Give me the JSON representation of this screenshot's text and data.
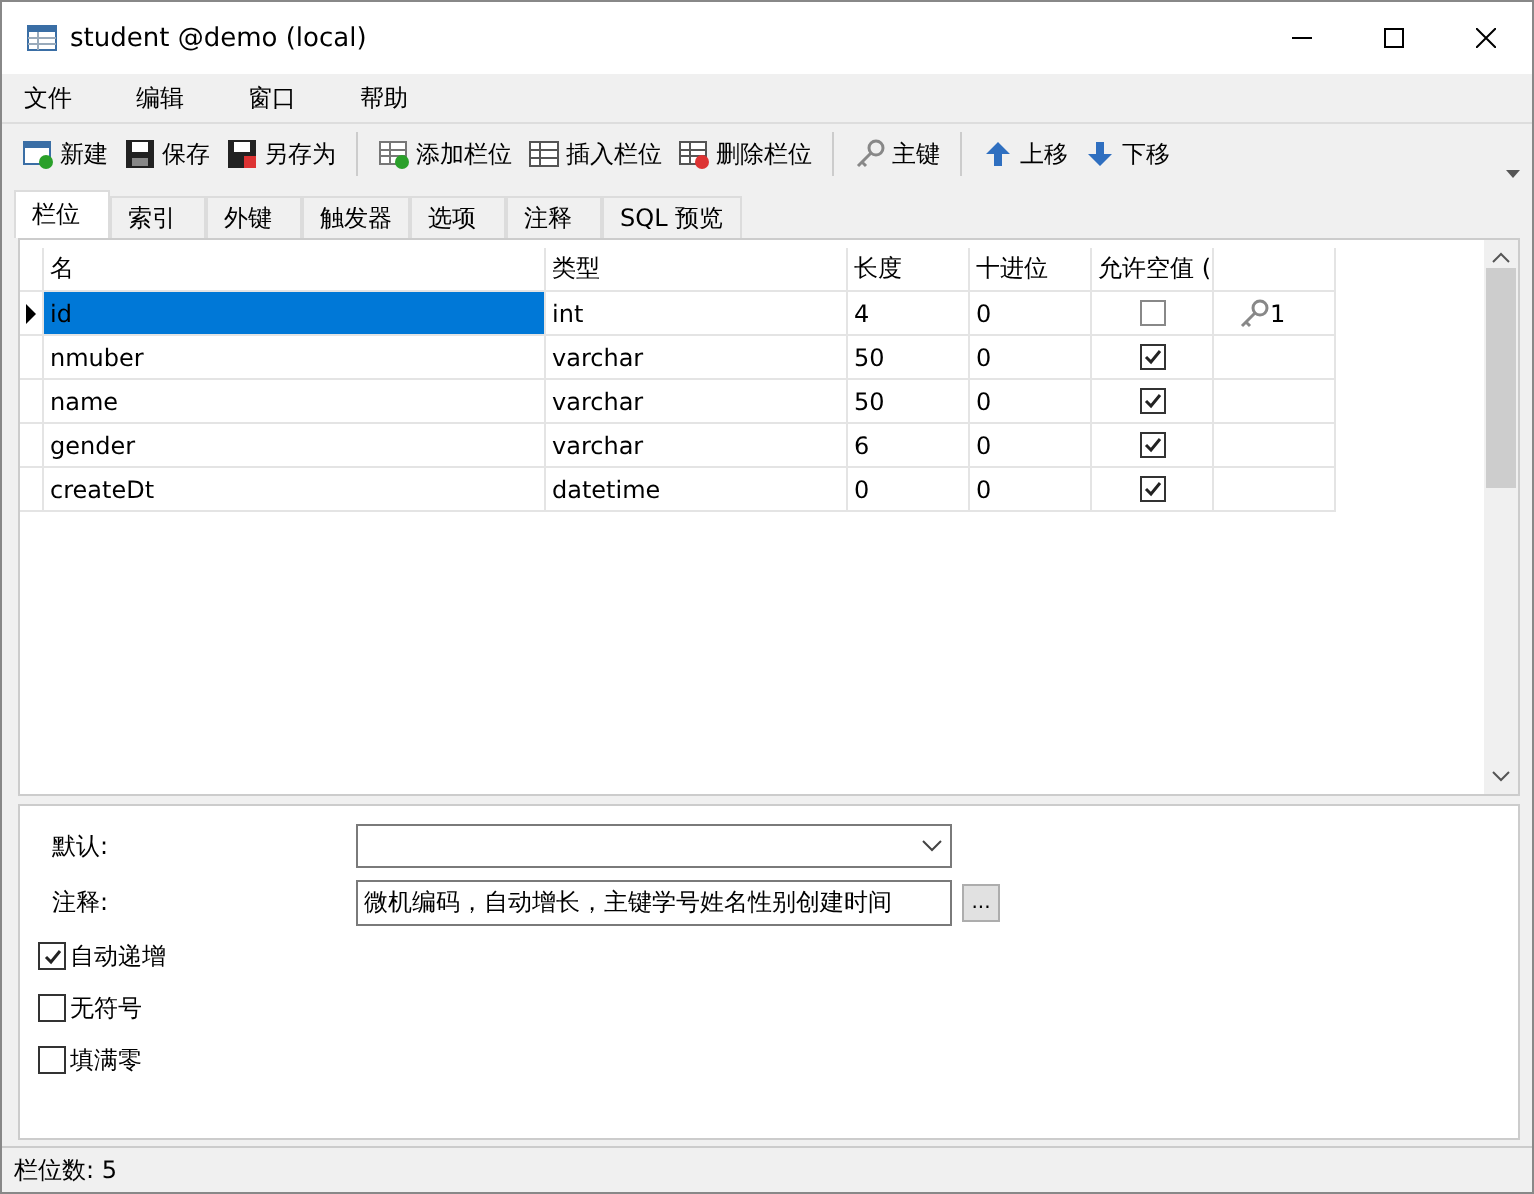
{
  "window": {
    "title": "student @demo (local)"
  },
  "menu": [
    "文件",
    "编辑",
    "窗口",
    "帮助"
  ],
  "toolbar": [
    [
      {
        "label": "新建",
        "kind": "new"
      },
      {
        "label": "保存",
        "kind": "save"
      },
      {
        "label": "另存为",
        "kind": "saveas"
      }
    ],
    [
      {
        "label": "添加栏位",
        "kind": "add"
      },
      {
        "label": "插入栏位",
        "kind": "insert"
      },
      {
        "label": "删除栏位",
        "kind": "delete"
      }
    ],
    [
      {
        "label": "主键",
        "kind": "key"
      }
    ],
    [
      {
        "label": "上移",
        "kind": "up"
      },
      {
        "label": "下移",
        "kind": "down"
      }
    ]
  ],
  "tabs": [
    {
      "label": "栏位",
      "selected": true
    },
    {
      "label": "索引",
      "selected": false
    },
    {
      "label": "外键",
      "selected": false
    },
    {
      "label": "触发器",
      "selected": false
    },
    {
      "label": "选项",
      "selected": false
    },
    {
      "label": "注释",
      "selected": false
    },
    {
      "label": "SQL 预览",
      "selected": false
    }
  ],
  "table": {
    "columns": [
      "名",
      "类型",
      "长度",
      "十进位",
      "允许空值 ("
    ],
    "rows": [
      {
        "name": "id",
        "type": "int",
        "length": "4",
        "decimals": "0",
        "nullable": false,
        "key": "1",
        "selected": true
      },
      {
        "name": "nmuber",
        "type": "varchar",
        "length": "50",
        "decimals": "0",
        "nullable": true,
        "selected": false
      },
      {
        "name": "name",
        "type": "varchar",
        "length": "50",
        "decimals": "0",
        "nullable": true,
        "selected": false
      },
      {
        "name": "gender",
        "type": "varchar",
        "length": "6",
        "decimals": "0",
        "nullable": true,
        "selected": false
      },
      {
        "name": "createDt",
        "type": "datetime",
        "length": "0",
        "decimals": "0",
        "nullable": true,
        "selected": false
      }
    ]
  },
  "properties": {
    "default_label": "默认:",
    "comment_label": "注释:",
    "comment_value": "微机编码，自动增长，主键学号姓名性别创建时间",
    "more_button": "...",
    "options": [
      {
        "label": "自动递增",
        "checked": true
      },
      {
        "label": "无符号",
        "checked": false
      },
      {
        "label": "填满零",
        "checked": false
      }
    ]
  },
  "status_bar": "栏位数: 5"
}
